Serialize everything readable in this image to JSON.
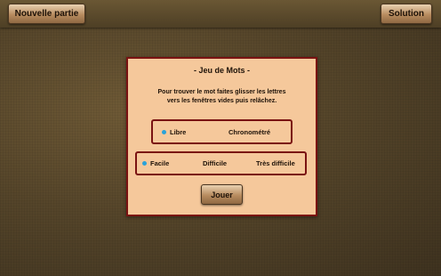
{
  "toolbar": {
    "new_game_label": "Nouvelle partie",
    "solution_label": "Solution"
  },
  "dialog": {
    "title": "-  Jeu de Mots  -",
    "description_line1": "Pour trouver le mot faites glisser les lettres",
    "description_line2": "vers les fenêtres vides puis relâchez.",
    "modes": [
      {
        "label": "Libre",
        "selected": true
      },
      {
        "label": "Chronométré",
        "selected": false
      }
    ],
    "difficulties": [
      {
        "label": "Facile",
        "selected": true
      },
      {
        "label": "Difficile",
        "selected": false
      },
      {
        "label": "Très difficile",
        "selected": false
      }
    ],
    "play_label": "Jouer"
  },
  "colors": {
    "selected_dot": "#2aa2d9",
    "dialog_background": "#f5c89b",
    "dialog_border": "#7a1212"
  }
}
